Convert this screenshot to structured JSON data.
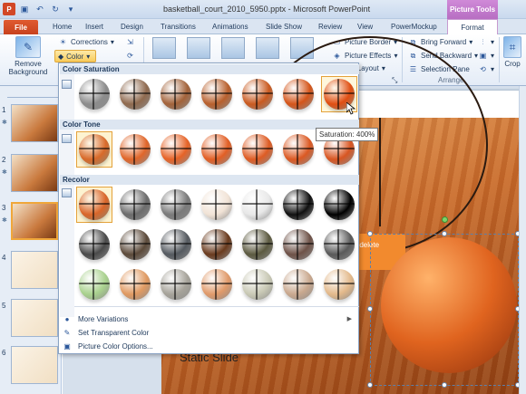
{
  "window": {
    "title": "basketball_court_2010_5950.pptx - Microsoft PowerPoint",
    "context_header": "Picture Tools"
  },
  "qat": {
    "app_icon": "P",
    "save_icon": "save-icon",
    "undo_icon": "undo-icon",
    "redo_icon": "redo-icon"
  },
  "tabs": {
    "file": "File",
    "items": [
      "Home",
      "Insert",
      "Design",
      "Transitions",
      "Animations",
      "Slide Show",
      "Review",
      "View",
      "PowerMockup"
    ],
    "format": "Format"
  },
  "ribbon": {
    "remove_background": "Remove Background",
    "corrections": "Corrections",
    "color": "Color",
    "picture_border": "Picture Border",
    "picture_effects": "Picture Effects",
    "picture_layout": "ure Layout",
    "bring_forward": "Bring Forward",
    "send_backward": "Send Backward",
    "selection_pane": "Selection Pane",
    "arrange_label": "Arrange",
    "crop": "Crop"
  },
  "dropdown": {
    "sections": {
      "saturation": "Color Saturation",
      "tone": "Color Tone",
      "recolor": "Recolor"
    },
    "saturation_swatches": [
      "#8c8c8c",
      "#8f6a4f",
      "#a3633a",
      "#b8602d",
      "#c95a20",
      "#d4551a",
      "#e04e12"
    ],
    "tone_swatches": [
      "#d86a2a",
      "#e0662a",
      "#e66327",
      "#e25f25",
      "#de5c24",
      "#db5923",
      "#d85622"
    ],
    "recolor_row1": [
      "#d9662a",
      "#6c6c6c",
      "#7a7a7a",
      "#f1e3d6",
      "#e8e8e8",
      "#111111",
      "#000000"
    ],
    "recolor_row2": [
      "#4a4a4a",
      "#5c4a3a",
      "#555a60",
      "#6a3b1e",
      "#5c5a40",
      "#6e5248",
      "#5a5a5a"
    ],
    "recolor_row3": [
      "#a9d18e",
      "#e09a62",
      "#a6a39a",
      "#e09a6a",
      "#c9c9b5",
      "#c9a88e",
      "#e3b98b"
    ],
    "menu": {
      "more_variations": "More Variations",
      "set_transparent": "Set Transparent Color",
      "picture_color_options": "Picture Color Options..."
    },
    "tooltip": "Saturation: 400%"
  },
  "slides": {
    "numbers": [
      "1",
      "2",
      "3",
      "4",
      "5",
      "6"
    ],
    "main_title": "Static Slide",
    "callout_text": "or delete"
  },
  "colors": {
    "accent": "#f28a2e",
    "selection": "#e4a23a",
    "file_tab": "#d24726",
    "context_tab": "#b76ec2"
  }
}
